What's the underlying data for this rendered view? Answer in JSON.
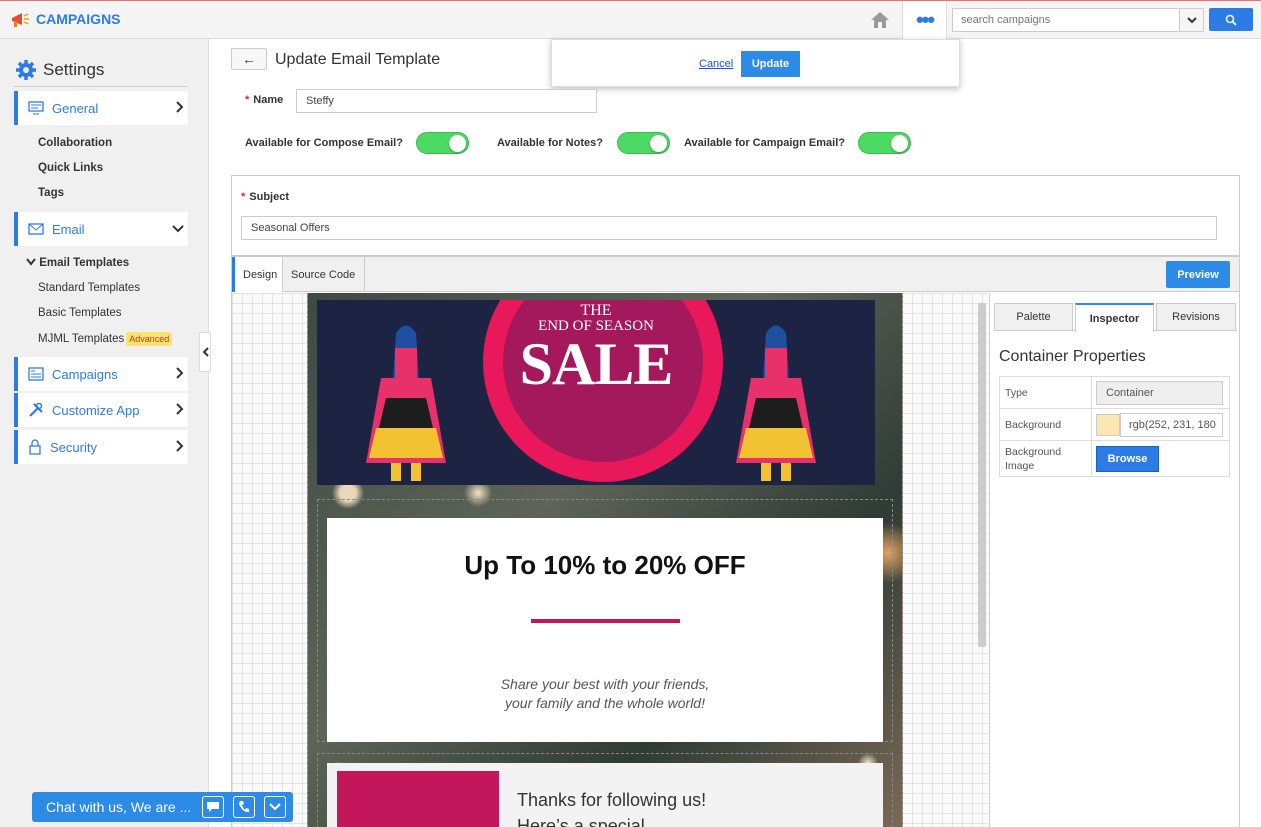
{
  "app": {
    "title": "CAMPAIGNS"
  },
  "search": {
    "placeholder": "search campaigns"
  },
  "sidebar": {
    "heading": "Settings",
    "sections": [
      {
        "label": "General"
      },
      {
        "label": "Email"
      },
      {
        "label": "Campaigns"
      },
      {
        "label": "Customize App"
      },
      {
        "label": "Security"
      }
    ],
    "general_items": [
      "Collaboration",
      "Quick Links",
      "Tags"
    ],
    "email_items": {
      "group": "Email Templates",
      "items": [
        "Standard Templates",
        "Basic Templates",
        "MJML Templates"
      ],
      "badge": "Advanced"
    }
  },
  "chat": {
    "label": "Chat with us, We are ..."
  },
  "page": {
    "title": "Update Email Template",
    "cancel": "Cancel",
    "update": "Update",
    "name_label": "Name",
    "name_value": "Steffy",
    "toggles": [
      {
        "label": "Available for Compose Email?",
        "on": true
      },
      {
        "label": "Available for Notes?",
        "on": true
      },
      {
        "label": "Available for Campaign Email?",
        "on": true
      }
    ],
    "subject_label": "Subject",
    "subject_value": "Seasonal Offers"
  },
  "editor": {
    "tabs": [
      "Design",
      "Source Code"
    ],
    "active_tab": "Design",
    "preview": "Preview"
  },
  "email": {
    "banner_the": "THE",
    "banner_end": "END OF SEASON",
    "banner_sale": "SALE",
    "headline": "Up To 10% to 20% OFF",
    "line1": "Share your best with your friends,",
    "line2": "your family and the whole world!",
    "thanks1": "Thanks for following us!",
    "thanks2": "Here’s a special"
  },
  "panel": {
    "tabs": [
      "Palette",
      "Inspector",
      "Revisions"
    ],
    "active_tab": "Inspector",
    "title": "Container Properties",
    "type_label": "Type",
    "type_value": "Container",
    "bg_label": "Background",
    "bg_value": "rgb(252, 231, 180",
    "bg_color": "#fce7b4",
    "bgimg_label": "Background Image",
    "browse": "Browse"
  },
  "colors": {
    "accent": "#2d7be5",
    "toggle_on": "#4cd964",
    "brand_pink": "#c2185b"
  }
}
